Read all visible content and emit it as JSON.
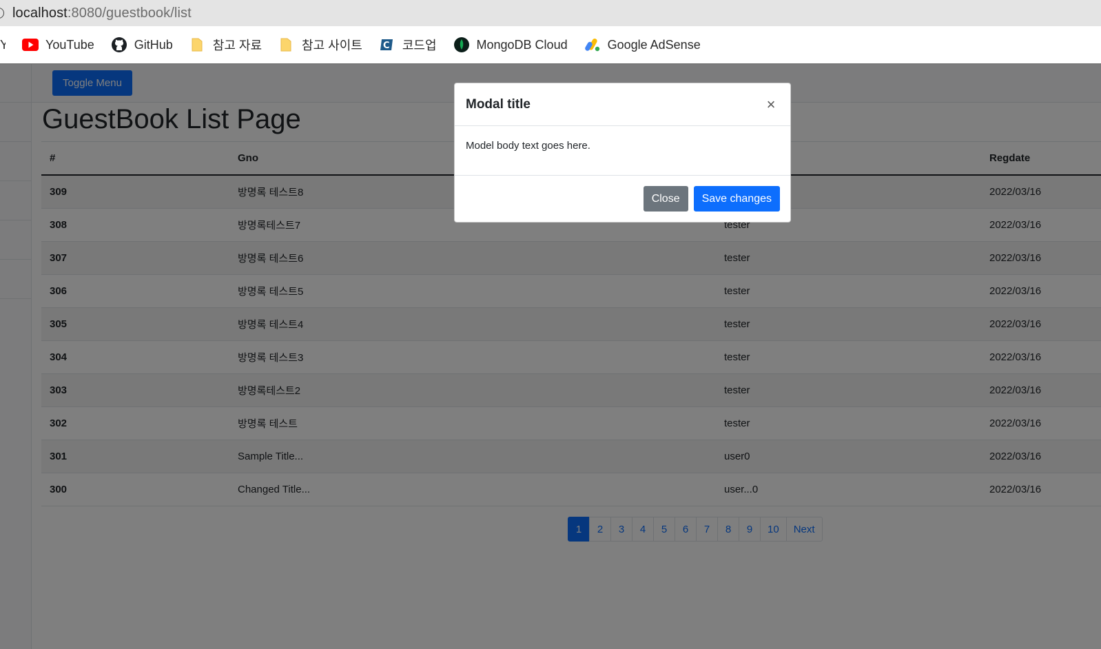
{
  "browser": {
    "url_host": "localhost",
    "url_rest": ":8080/guestbook/list",
    "bookmarks": [
      {
        "label": "YouTube",
        "icon": "youtube-icon"
      },
      {
        "label": "GitHub",
        "icon": "github-icon"
      },
      {
        "label": "참고 자료",
        "icon": "folder-icon"
      },
      {
        "label": "참고 사이트",
        "icon": "folder-icon"
      },
      {
        "label": "코드업",
        "icon": "codeup-icon"
      },
      {
        "label": "MongoDB Cloud",
        "icon": "mongodb-icon"
      },
      {
        "label": "Google AdSense",
        "icon": "adsense-icon"
      }
    ]
  },
  "page": {
    "toggle_menu": "Toggle Menu",
    "title": "GuestBook List Page",
    "table": {
      "headers": [
        "#",
        "Gno",
        "",
        "Regdate"
      ],
      "rows": [
        {
          "num": "309",
          "title": "방명록 테스트8",
          "writer": "",
          "regdate": "2022/03/16"
        },
        {
          "num": "308",
          "title": "방명록테스트7",
          "writer": "tester",
          "regdate": "2022/03/16"
        },
        {
          "num": "307",
          "title": "방명록 테스트6",
          "writer": "tester",
          "regdate": "2022/03/16"
        },
        {
          "num": "306",
          "title": "방명록 테스트5",
          "writer": "tester",
          "regdate": "2022/03/16"
        },
        {
          "num": "305",
          "title": "방명록 테스트4",
          "writer": "tester",
          "regdate": "2022/03/16"
        },
        {
          "num": "304",
          "title": "방명록 테스트3",
          "writer": "tester",
          "regdate": "2022/03/16"
        },
        {
          "num": "303",
          "title": "방명록테스트2",
          "writer": "tester",
          "regdate": "2022/03/16"
        },
        {
          "num": "302",
          "title": "방명록 테스트",
          "writer": "tester",
          "regdate": "2022/03/16"
        },
        {
          "num": "301",
          "title": "Sample Title...",
          "writer": "user0",
          "regdate": "2022/03/16"
        },
        {
          "num": "300",
          "title": "Changed Title...",
          "writer": "user...0",
          "regdate": "2022/03/16"
        }
      ]
    },
    "pagination": {
      "pages": [
        "1",
        "2",
        "3",
        "4",
        "5",
        "6",
        "7",
        "8",
        "9",
        "10"
      ],
      "active": "1",
      "next": "Next"
    }
  },
  "modal": {
    "title": "Modal title",
    "close_glyph": "×",
    "body": "Model body text goes here.",
    "close_button": "Close",
    "save_button": "Save changes"
  },
  "colors": {
    "primary": "#0d6efd",
    "secondary": "#6c757d",
    "backdrop": "rgba(0,0,0,0.5)"
  }
}
